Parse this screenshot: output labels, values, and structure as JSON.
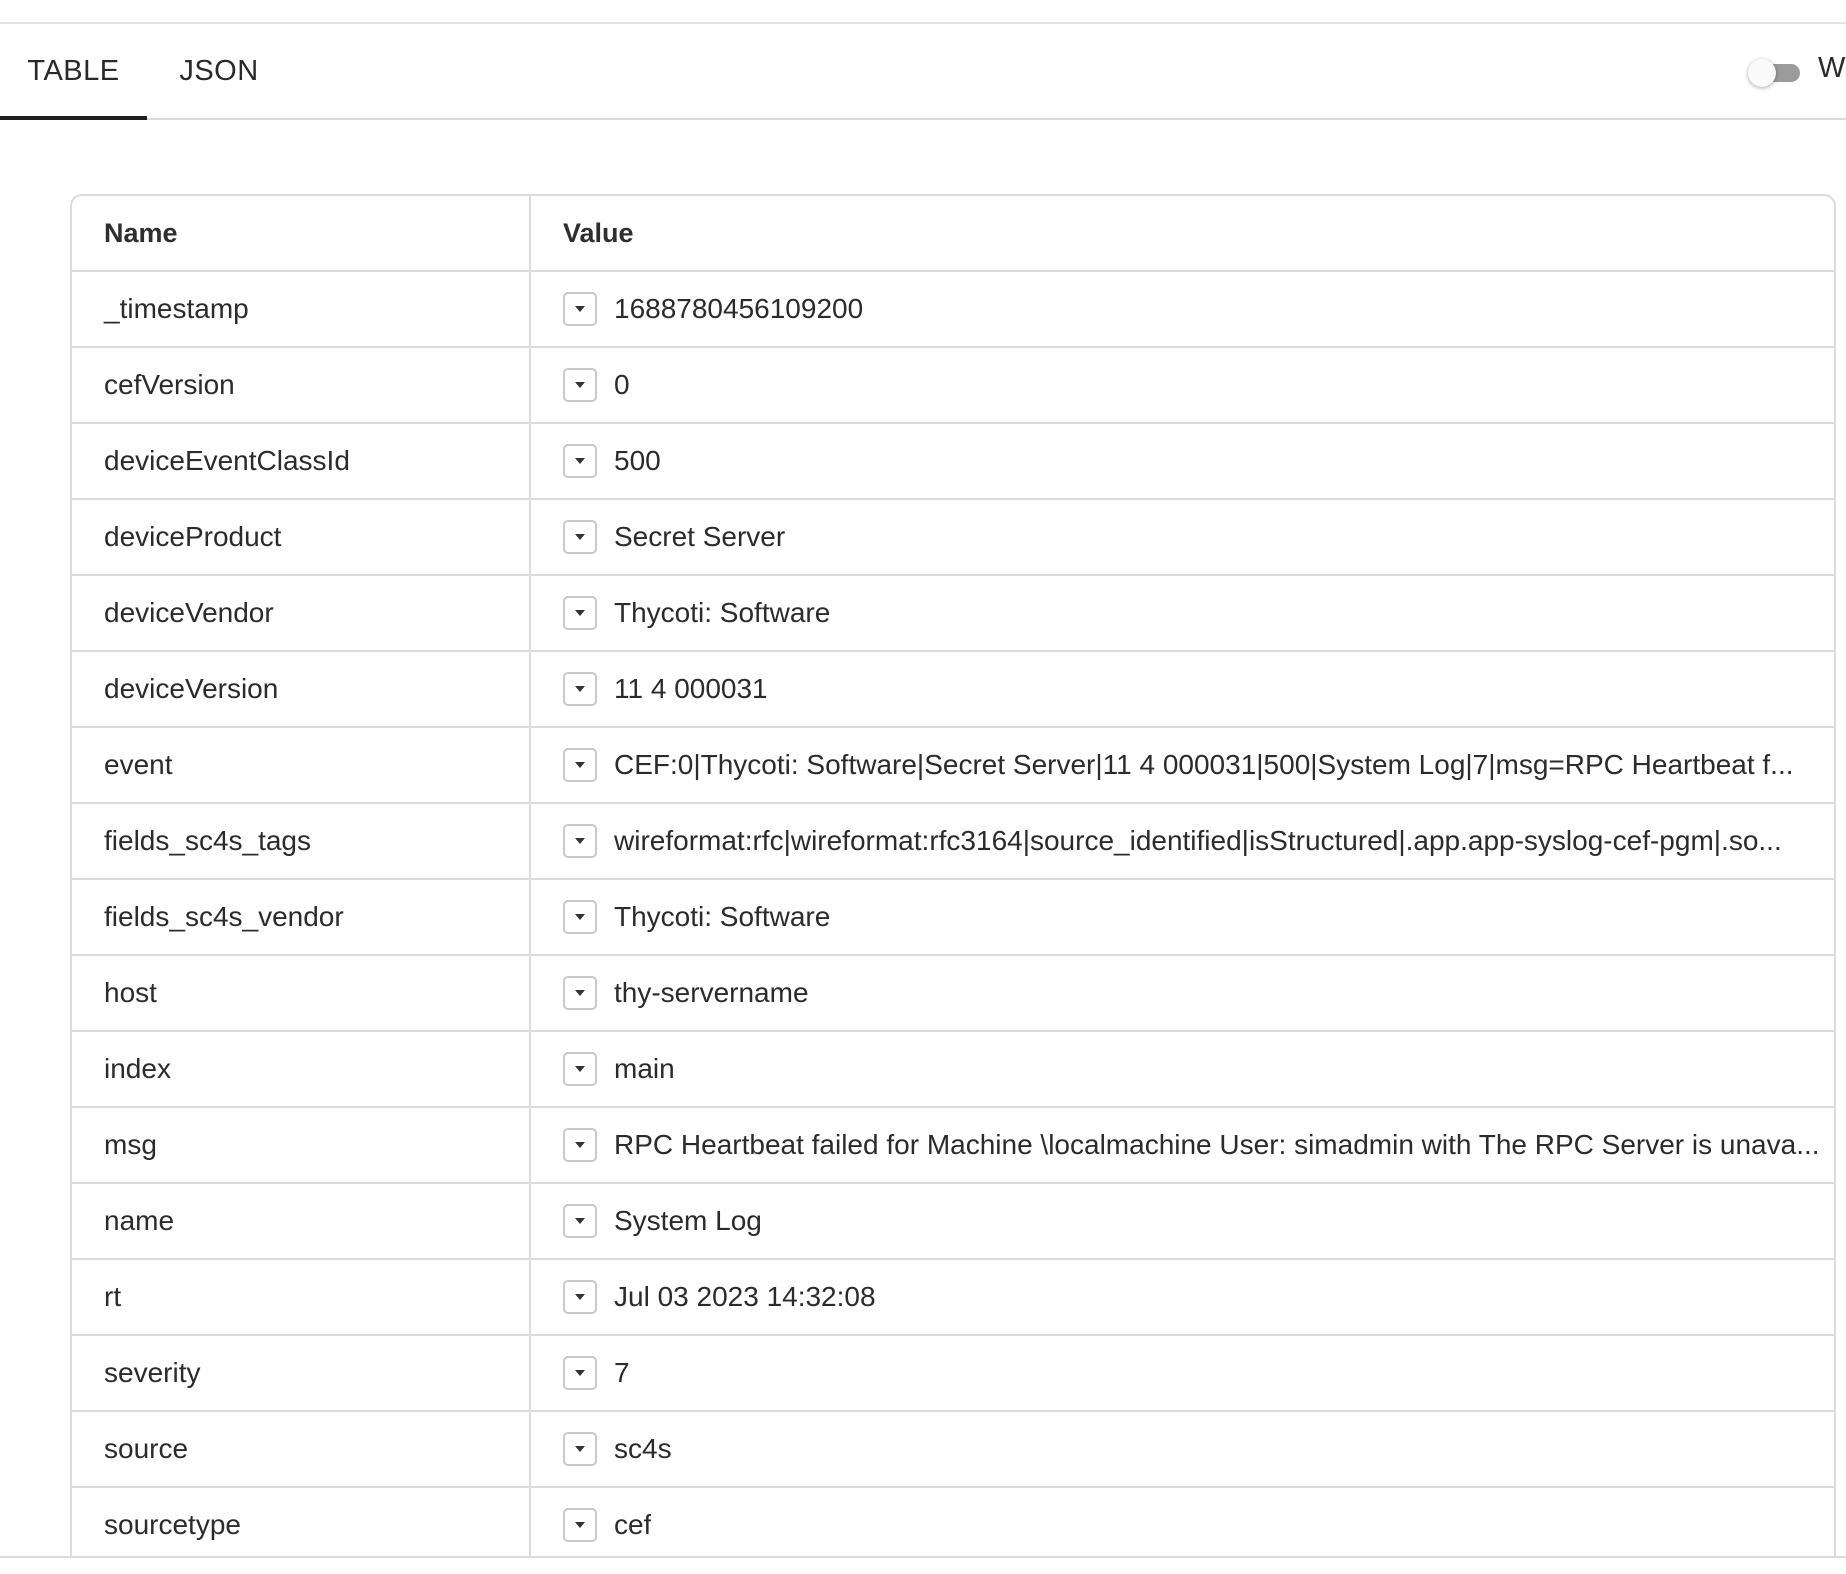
{
  "tabs": {
    "table_label": "TABLE",
    "json_label": "JSON"
  },
  "toggle": {
    "label": "W",
    "state": "off"
  },
  "table": {
    "headers": {
      "name": "Name",
      "value": "Value"
    },
    "rows": [
      {
        "name": "_timestamp",
        "value": "1688780456109200"
      },
      {
        "name": "cefVersion",
        "value": "0"
      },
      {
        "name": "deviceEventClassId",
        "value": "500"
      },
      {
        "name": "deviceProduct",
        "value": "Secret Server"
      },
      {
        "name": "deviceVendor",
        "value": "Thycoti: Software"
      },
      {
        "name": "deviceVersion",
        "value": "11 4 000031"
      },
      {
        "name": "event",
        "value": "CEF:0|Thycoti: Software|Secret Server|11 4 000031|500|System Log|7|msg=RPC Heartbeat f..."
      },
      {
        "name": "fields_sc4s_tags",
        "value": "wireformat:rfc|wireformat:rfc3164|source_identified|isStructured|.app.app-syslog-cef-pgm|.so..."
      },
      {
        "name": "fields_sc4s_vendor",
        "value": "Thycoti: Software"
      },
      {
        "name": "host",
        "value": "thy-servername"
      },
      {
        "name": "index",
        "value": "main"
      },
      {
        "name": "msg",
        "value": "RPC Heartbeat failed for Machine \\localmachine User: simadmin with The RPC Server is unava..."
      },
      {
        "name": "name",
        "value": "System Log"
      },
      {
        "name": "rt",
        "value": "Jul 03 2023 14:32:08"
      },
      {
        "name": "severity",
        "value": "7"
      },
      {
        "name": "source",
        "value": "sc4s"
      },
      {
        "name": "sourcetype",
        "value": "cef"
      }
    ]
  }
}
